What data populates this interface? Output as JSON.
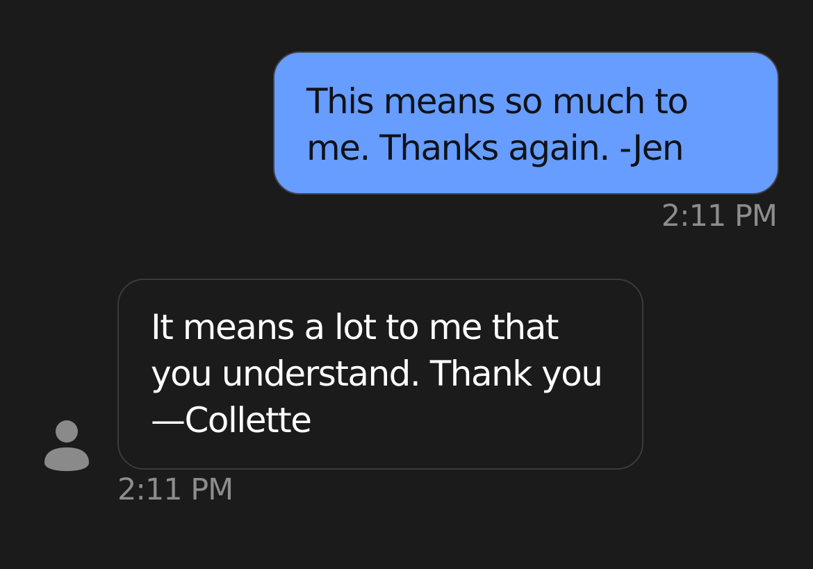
{
  "conversation": {
    "messages": [
      {
        "direction": "outgoing",
        "text": "This means so much to me. Thanks again. -Jen",
        "time": "2:11 PM"
      },
      {
        "direction": "incoming",
        "text": "It means a lot to me that you understand. Thank you—Collette",
        "time": "2:11 PM",
        "avatar_icon": "default-contact-icon"
      }
    ]
  },
  "colors": {
    "background": "#1b1b1b",
    "outgoing_bubble": "#669dff",
    "incoming_bubble_border": "#3b3b3b",
    "timestamp": "#8d8d8d"
  }
}
